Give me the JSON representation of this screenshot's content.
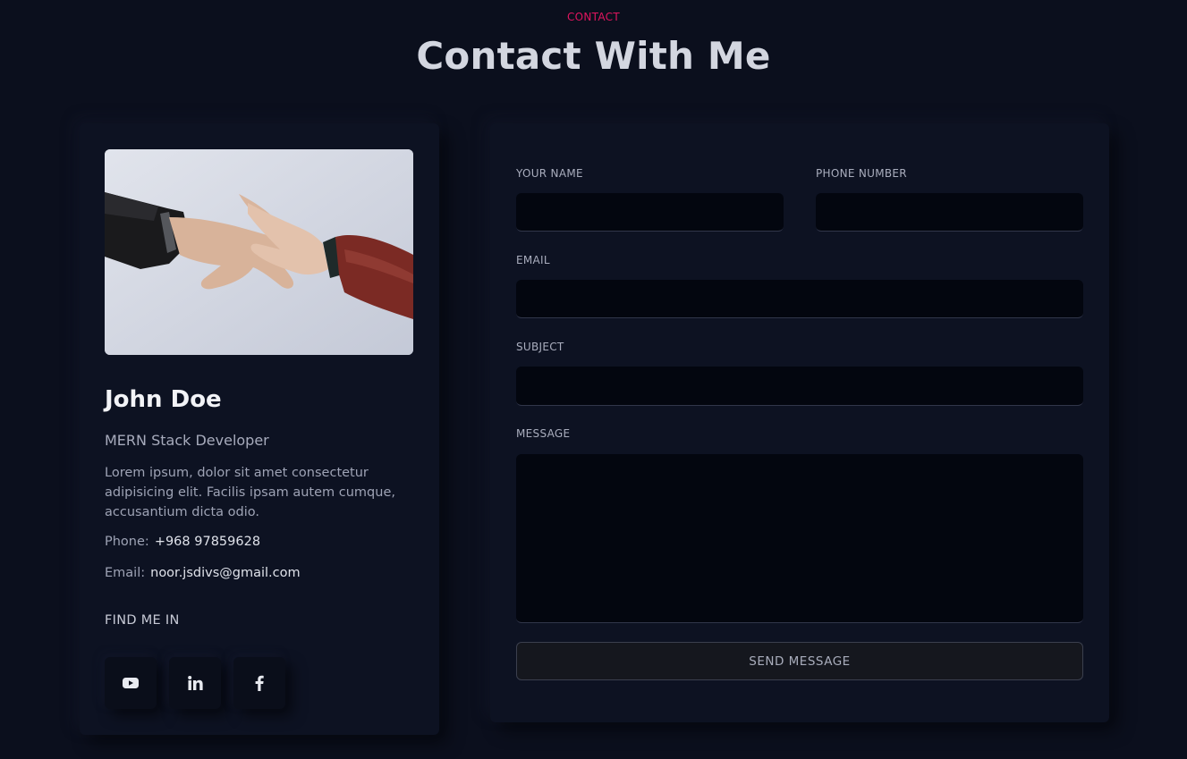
{
  "header": {
    "eyebrow": "CONTACT",
    "title": "Contact With Me"
  },
  "profile": {
    "image_alt": "handshake-photo",
    "name": "John Doe",
    "role": "MERN Stack Developer",
    "description": "Lorem ipsum, dolor sit amet consectetur adipisicing elit. Facilis ipsam autem cumque, accusantium dicta odio.",
    "phone_label": "Phone:",
    "phone_value": "+968 97859628",
    "email_label": "Email:",
    "email_value": "noor.jsdivs@gmail.com",
    "find_me_label": "FIND ME IN",
    "socials": [
      {
        "icon": "youtube-icon"
      },
      {
        "icon": "linkedin-icon"
      },
      {
        "icon": "facebook-icon"
      }
    ]
  },
  "form": {
    "name_label": "YOUR NAME",
    "name_value": "",
    "phone_label": "PHONE NUMBER",
    "phone_value": "",
    "email_label": "EMAIL",
    "email_value": "",
    "subject_label": "SUBJECT",
    "subject_value": "",
    "message_label": "MESSAGE",
    "message_value": "",
    "submit_label": "SEND MESSAGE"
  },
  "colors": {
    "background": "#0b0f1d",
    "card": "#0d1222",
    "input": "#03060f",
    "accent": "#e0155e"
  }
}
